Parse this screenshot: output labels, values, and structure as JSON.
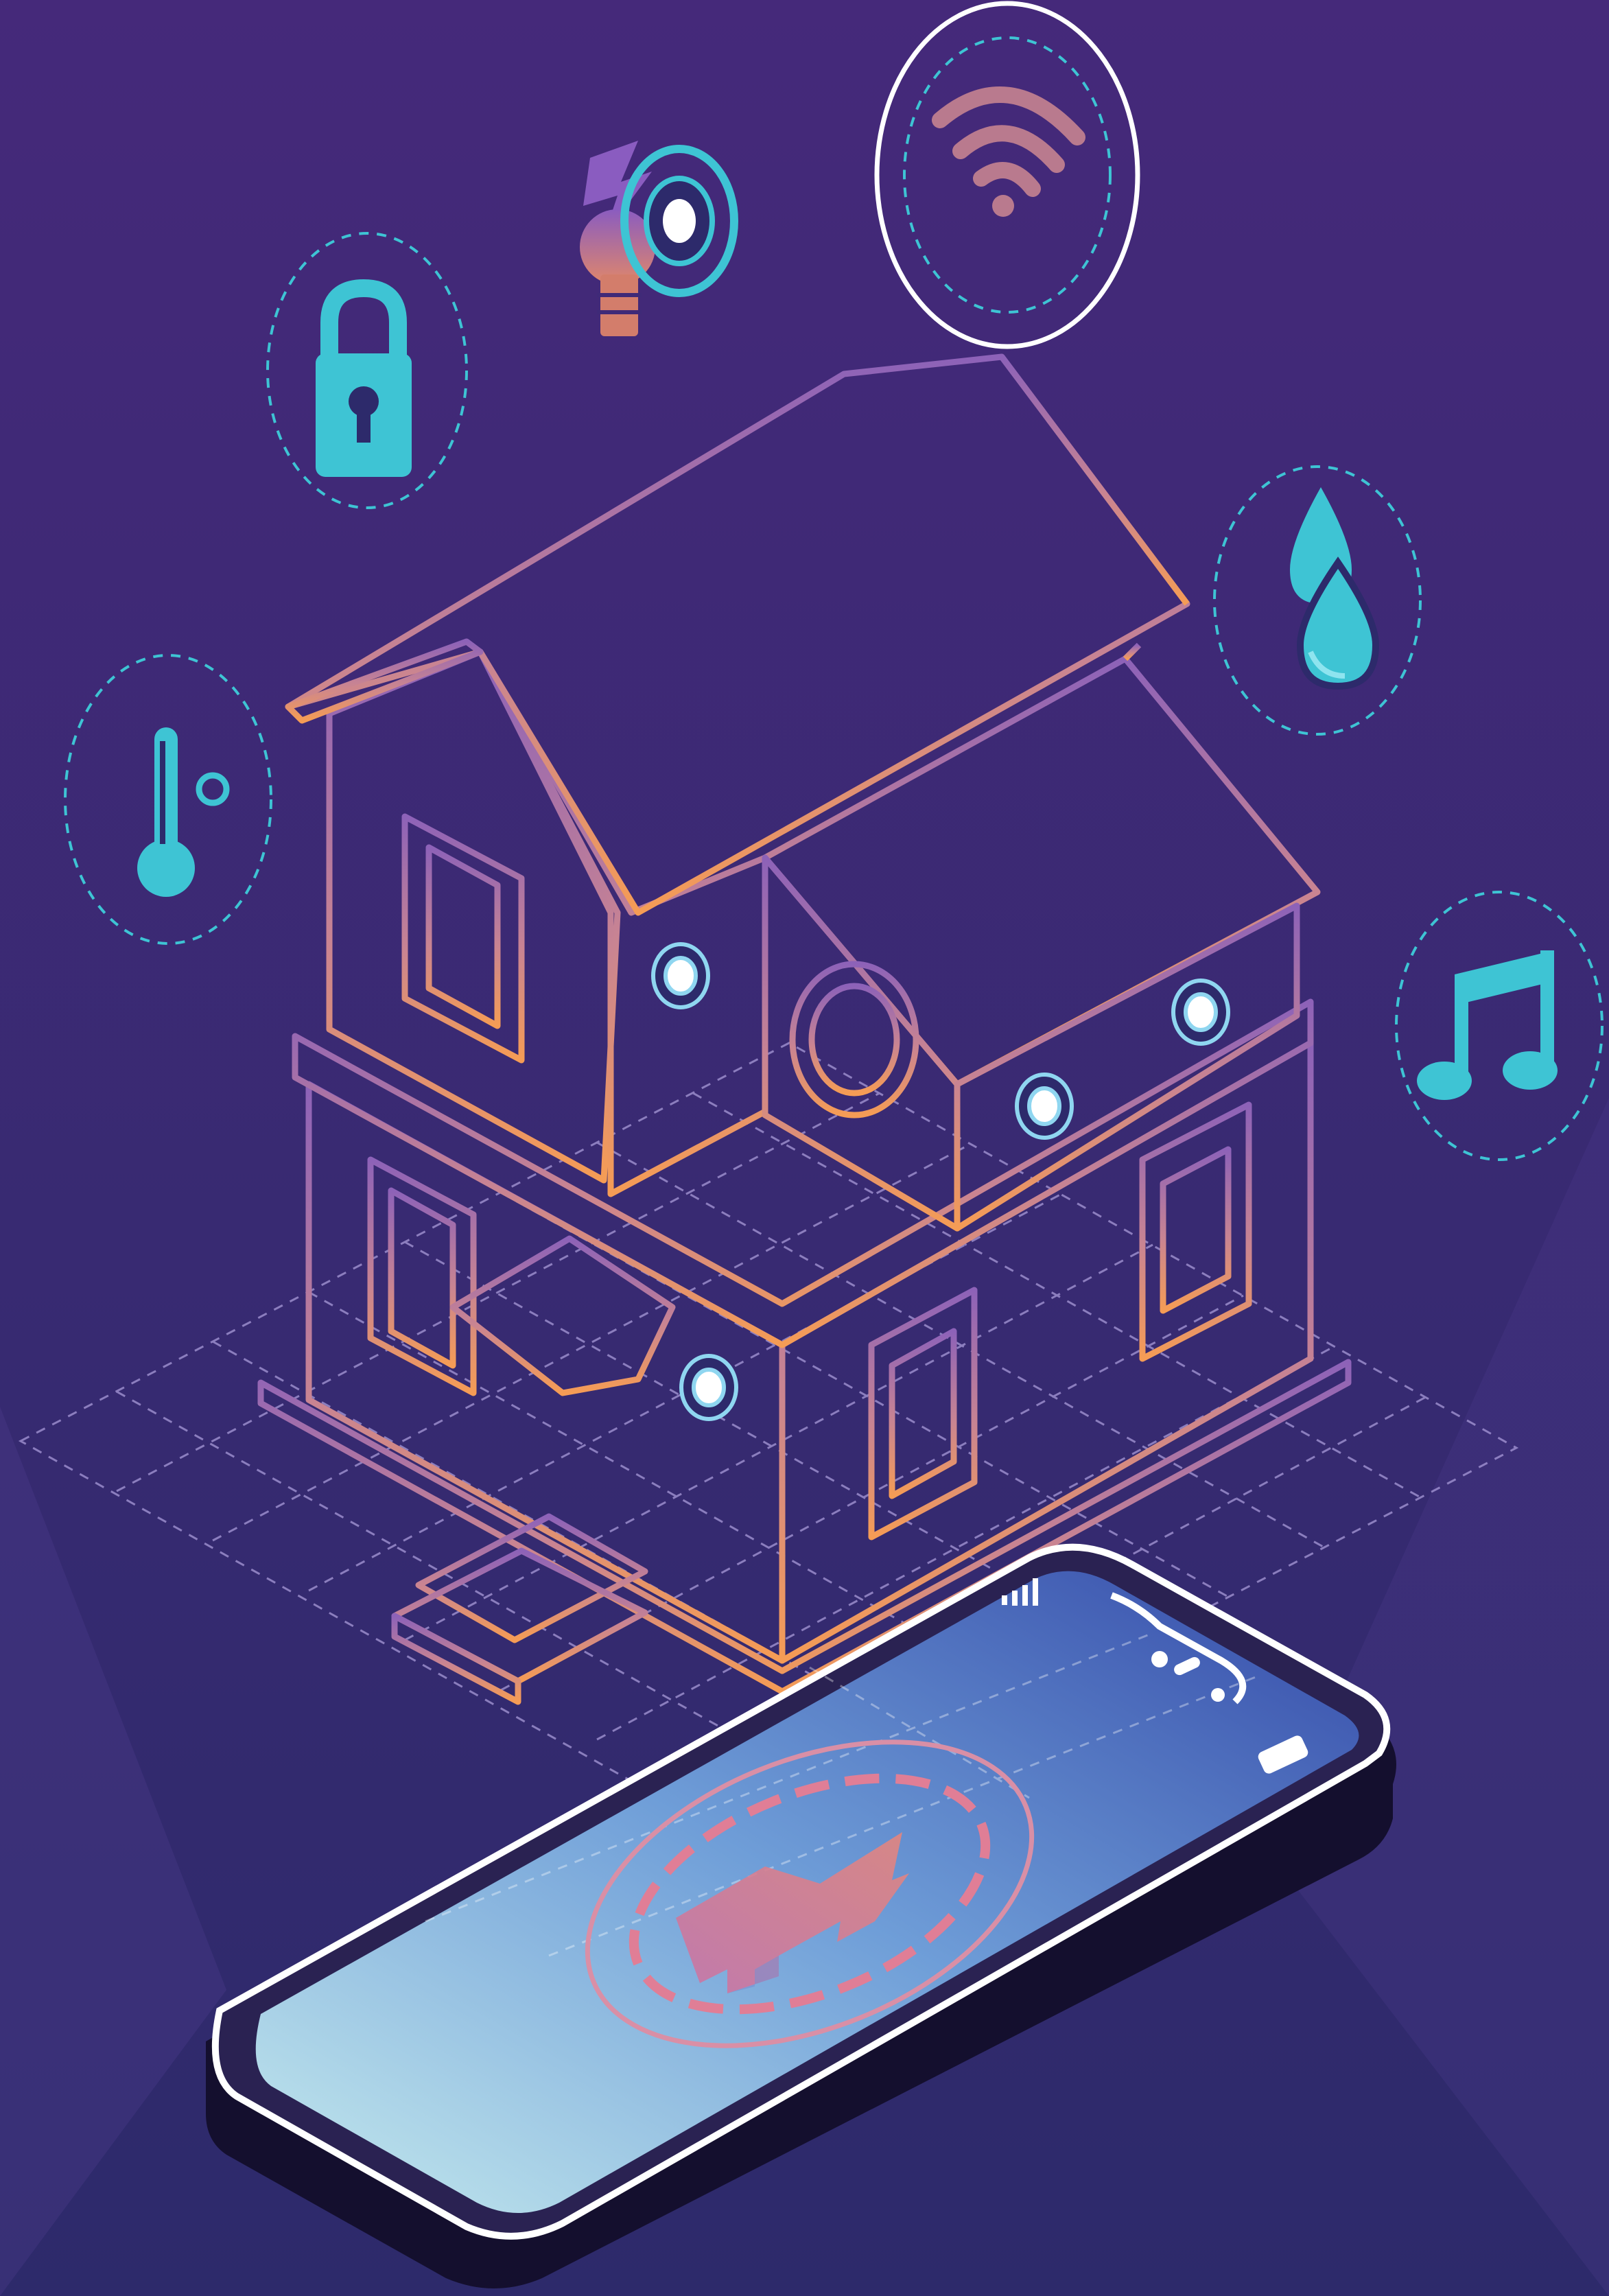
{
  "scene": {
    "subject": "smart-home-illustration",
    "colors": {
      "background_top": "#45297a",
      "background_bottom": "#2d2a6b",
      "icon_cyan": "#3ec4d4",
      "house_top": "#9a6ab8",
      "house_bottom": "#f59a55",
      "phone_screen_light": "#bfe3ea",
      "phone_screen_dark": "#3a55b0",
      "phone_frame": "#1a1436",
      "accent_pink": "#c87aa8",
      "grid_line": "#a89ad8"
    },
    "icons": [
      "thermometer-icon",
      "lock-icon",
      "light-bulb-icon",
      "wifi-icon",
      "water-drop-icon",
      "music-note-icon",
      "home-upload-icon",
      "signal-bars-icon",
      "battery-icon"
    ]
  }
}
